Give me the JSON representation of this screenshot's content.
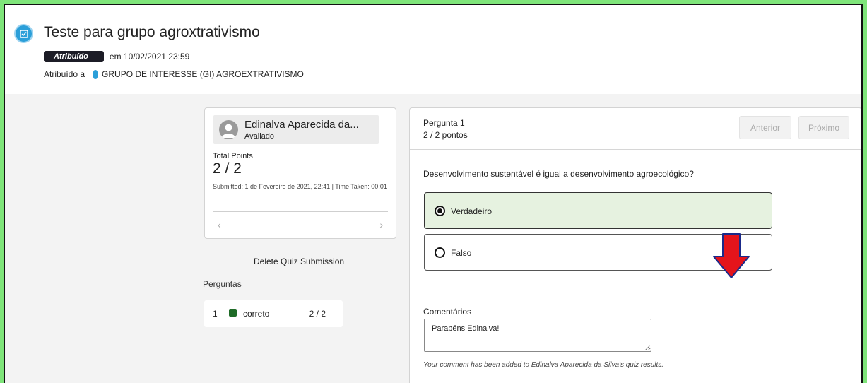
{
  "header": {
    "title": "Teste para grupo agroxtrativismo",
    "status_badge": "Atribuído",
    "due_text": "em 10/02/2021 23:59",
    "assigned_to_label": "Atribuído a",
    "group_name": "GRUPO DE INTERESSE (GI) AGROEXTRATIVISMO"
  },
  "student_card": {
    "name": "Edinalva Aparecida da...",
    "status": "Avaliado",
    "total_points_label": "Total Points",
    "total_points_value": "2 / 2",
    "submitted_text": "Submitted: 1 de Fevereiro de 2021, 22:41 | Time Taken: 00:01",
    "prev_icon": "chevron-left-icon",
    "next_icon": "chevron-right-icon"
  },
  "delete_link": "Delete Quiz Submission",
  "questions_section": {
    "heading": "Perguntas",
    "items": [
      {
        "number": "1",
        "status": "correto",
        "score": "2 / 2",
        "status_color": "#1e6b27"
      }
    ]
  },
  "question_panel": {
    "title": "Pergunta 1",
    "points": "2 / 2 pontos",
    "prev_label": "Anterior",
    "next_label": "Próximo",
    "question_text": "Desenvolvimento sustentável é igual a desenvolvimento agroecológico?",
    "answers": [
      {
        "label": "Verdadeiro",
        "selected": true
      },
      {
        "label": "Falso",
        "selected": false
      }
    ],
    "comments_label": "Comentários",
    "comment_value": "Parabéns Edinalva!",
    "confirmation": "Your comment has been added to Edinalva Aparecida da Silva's quiz results."
  },
  "colors": {
    "page_border": "#7fe57a",
    "accent_blue": "#2b9fd9",
    "correct_green": "#1e6b27",
    "selected_answer_bg": "#e6f2e0",
    "annotation_arrow": "#e4141b"
  }
}
